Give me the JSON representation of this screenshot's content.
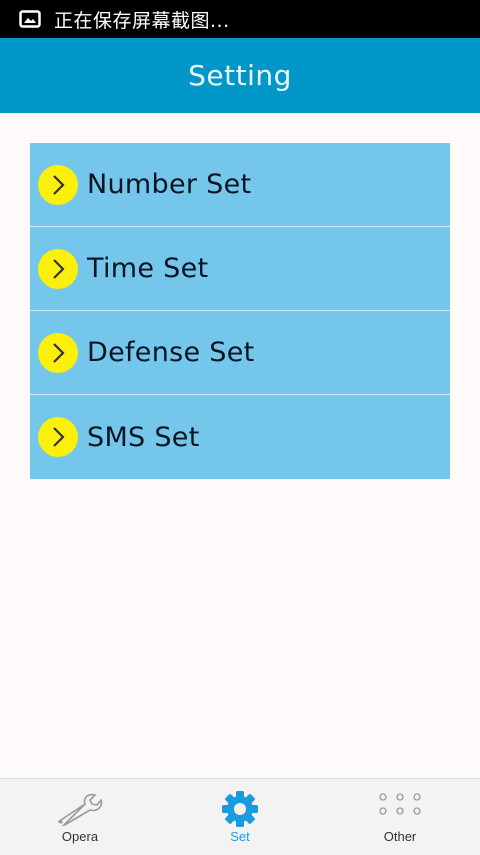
{
  "status_bar": {
    "text": "正在保存屏幕截图...",
    "icon": "image-icon"
  },
  "app_bar": {
    "title": "Setting"
  },
  "settings": {
    "items": [
      {
        "label": "Number Set",
        "icon": "chevron-right-icon"
      },
      {
        "label": "Time Set",
        "icon": "chevron-right-icon"
      },
      {
        "label": "Defense Set",
        "icon": "chevron-right-icon"
      },
      {
        "label": "SMS Set",
        "icon": "chevron-right-icon"
      }
    ]
  },
  "tab_bar": {
    "tabs": [
      {
        "label": "Opera",
        "icon": "wrench-icon",
        "active": false
      },
      {
        "label": "Set",
        "icon": "gear-icon",
        "active": true
      },
      {
        "label": "Other",
        "icon": "dots-grid-icon",
        "active": false
      }
    ]
  },
  "colors": {
    "status_bar": "#000000",
    "app_bar": "#0197c9",
    "list_background": "#75c6eb",
    "chevron_circle": "#fbf00b",
    "active_tab": "#1a9be0",
    "page_background": "#fffbfa"
  }
}
